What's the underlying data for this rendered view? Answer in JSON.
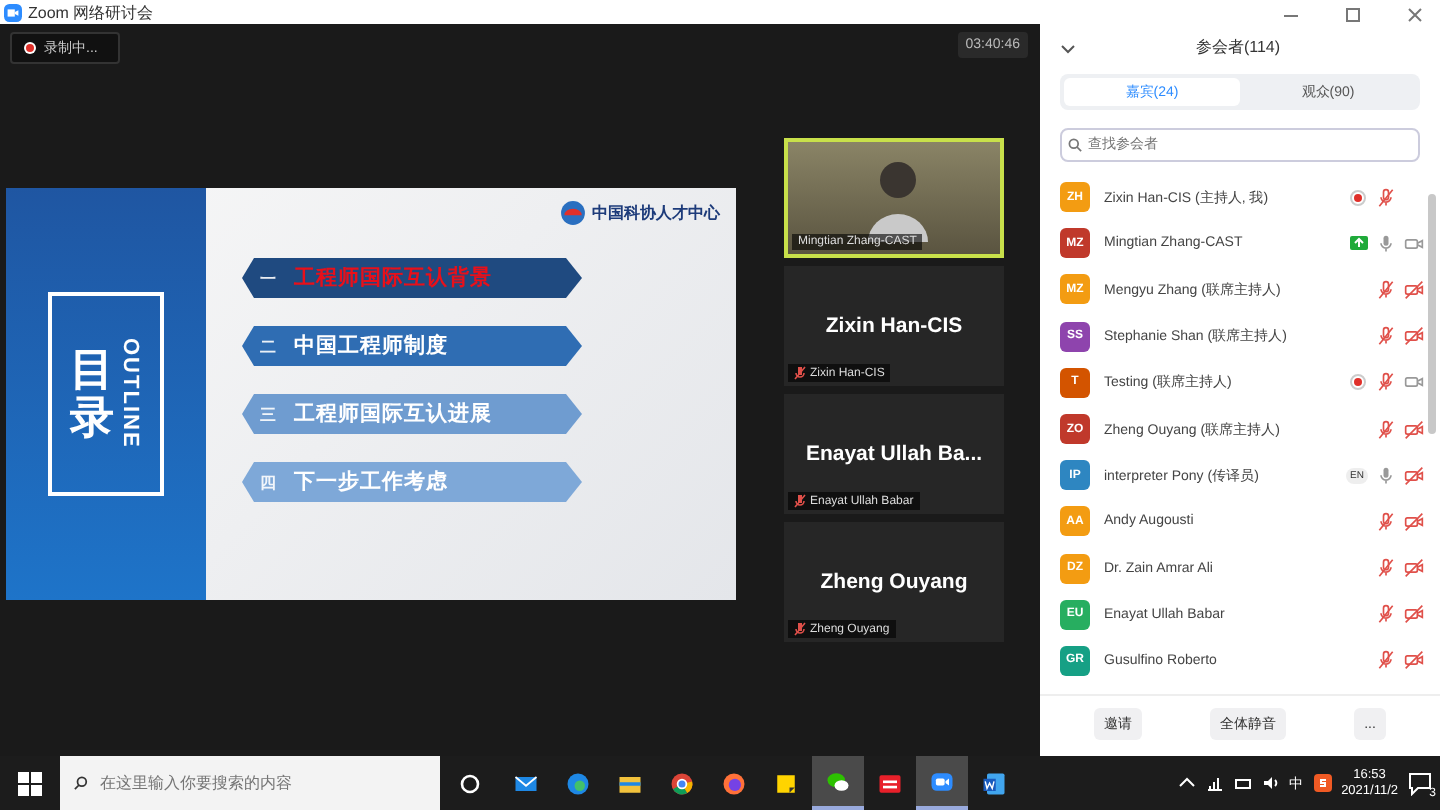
{
  "window": {
    "title": "Zoom 网络研讨会"
  },
  "stage": {
    "recording_label": "录制中...",
    "timer": "03:40:46",
    "slide": {
      "title": "目录",
      "subtitle": "OUTLINE",
      "logo_text": "中国科协人才中心",
      "items": [
        {
          "number": "一",
          "text": "工程师国际互认背景",
          "selected": true,
          "color": "#1f4a80"
        },
        {
          "number": "二",
          "text": "中国工程师制度",
          "selected": false,
          "color": "#2f6db3"
        },
        {
          "number": "三",
          "text": "工程师国际互认进展",
          "selected": false,
          "color": "#6f9cd0"
        },
        {
          "number": "四",
          "text": "下一步工作考虑",
          "selected": false,
          "color": "#7ea8d8"
        }
      ]
    },
    "videos": [
      {
        "kind": "camera",
        "label": "Mingtian Zhang-CAST",
        "active": true
      },
      {
        "kind": "name",
        "name": "Zixin Han-CIS",
        "label": "Zixin Han-CIS",
        "active": false
      },
      {
        "kind": "name",
        "name": "Enayat Ullah Ba...",
        "label": "Enayat Ullah Babar",
        "active": false
      },
      {
        "kind": "name",
        "name": "Zheng Ouyang",
        "label": "Zheng Ouyang",
        "active": false
      }
    ]
  },
  "panel": {
    "title": "参会者(114)",
    "tabs": [
      {
        "label": "嘉宾(24)",
        "selected": true
      },
      {
        "label": "观众(90)",
        "selected": false
      }
    ],
    "search": {
      "placeholder": "查找参会者"
    },
    "participants": [
      {
        "initials": "ZH",
        "name": "Zixin Han-CIS (主持人, 我)",
        "color": "#f39c12",
        "recording": true,
        "sharing": false,
        "muted": true
      },
      {
        "initials": "MZ",
        "name": "Mingtian Zhang-CAST",
        "color": "#c0392b",
        "recording": false,
        "sharing": true,
        "muted": false,
        "video_on": true
      },
      {
        "initials": "MZ",
        "name": "Mengyu Zhang (联席主持人)",
        "color": "#f39c12",
        "recording": false,
        "sharing": false,
        "muted": true,
        "video_on": false
      },
      {
        "initials": "SS",
        "name": "Stephanie Shan (联席主持人)",
        "color": "#8e44ad",
        "recording": false,
        "sharing": false,
        "muted": true,
        "video_on": false
      },
      {
        "initials": "T",
        "name": "Testing (联席主持人)",
        "color": "#d35400",
        "recording": true,
        "sharing": false,
        "muted": true,
        "video_on": true
      },
      {
        "initials": "ZO",
        "name": "Zheng Ouyang (联席主持人)",
        "color": "#c0392b",
        "recording": false,
        "sharing": false,
        "muted": true,
        "video_on": false
      },
      {
        "initials": "IP",
        "name": "interpreter Pony (传译员)",
        "color": "#2e86c1",
        "recording": false,
        "sharing": false,
        "badge": "EN",
        "muted": false,
        "video_on": false
      },
      {
        "initials": "AA",
        "name": "Andy Augousti",
        "color": "#f39c12",
        "recording": false,
        "sharing": false,
        "muted": true,
        "video_on": false
      },
      {
        "initials": "DZ",
        "name": "Dr. Zain Amrar Ali",
        "color": "#f39c12",
        "recording": false,
        "sharing": false,
        "muted": true,
        "video_on": false
      },
      {
        "initials": "EU",
        "name": "Enayat Ullah Babar",
        "color": "#27ae60",
        "recording": false,
        "sharing": false,
        "muted": true,
        "video_on": false
      },
      {
        "initials": "GR",
        "name": "Gusulfino Roberto",
        "color": "#16a085",
        "recording": false,
        "sharing": false,
        "muted": true,
        "video_on": false
      }
    ],
    "buttons": [
      "邀请",
      "全体静音",
      "..."
    ]
  },
  "taskbar": {
    "search": {
      "placeholder": "在这里输入你要搜索的内容"
    },
    "apps": [
      {
        "kind": "mail",
        "selected": false
      },
      {
        "kind": "edge",
        "selected": false
      },
      {
        "kind": "folder",
        "selected": false
      },
      {
        "kind": "chrome",
        "selected": false
      },
      {
        "kind": "firefox",
        "selected": false
      },
      {
        "kind": "notes",
        "selected": false
      },
      {
        "kind": "wechat",
        "selected": true
      },
      {
        "kind": "red",
        "selected": false
      },
      {
        "kind": "zoom",
        "selected": true
      },
      {
        "kind": "word",
        "selected": false
      }
    ],
    "ime": "中",
    "time": "16:53",
    "date": "2021/11/2",
    "notifications": "3"
  }
}
